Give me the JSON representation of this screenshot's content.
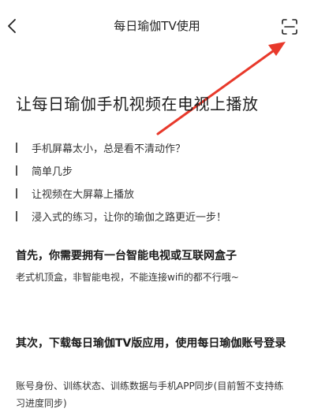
{
  "header": {
    "title": "每日瑜伽TV使用",
    "back_icon": "chevron-left-icon",
    "scan_icon": "scan-icon"
  },
  "annotation": {
    "arrow_color": "#e8392b"
  },
  "main": {
    "title": "让每日瑜伽手机视频在电视上播放",
    "bullets": [
      "手机屏幕太小，总是看不清动作？",
      "简单几步",
      "让视频在大屏幕上播放",
      "浸入式的练习，让你的瑜伽之路更近一步！"
    ],
    "section1": {
      "heading": "首先，你需要拥有一台智能电视或互联网盒子",
      "desc": "老式机顶盒，非智能电视，不能连接wifi的都不行哦~"
    },
    "section2": {
      "heading": "其次，下载每日瑜伽TV版应用，使用每日瑜伽账号登录",
      "desc": "账号身份、训练状态、训练数据与手机APP同步(目前暂不支持练习进度同步)"
    }
  }
}
